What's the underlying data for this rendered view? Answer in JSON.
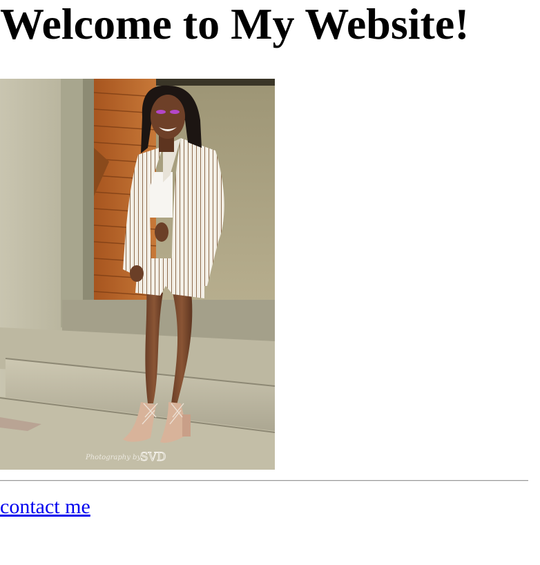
{
  "page": {
    "title": "Welcome to My Website!",
    "photo": {
      "alt": "Photo of a smiling woman in a white pinstripe blazer and shorts standing on concrete steps",
      "watermark_script": "Photography by",
      "watermark_mark": "SVD"
    },
    "link": {
      "label": "contact me",
      "color": "#0000ee"
    },
    "colors": {
      "background": "#ffffff",
      "text": "#000000",
      "divider": "#9a9a9a"
    }
  }
}
